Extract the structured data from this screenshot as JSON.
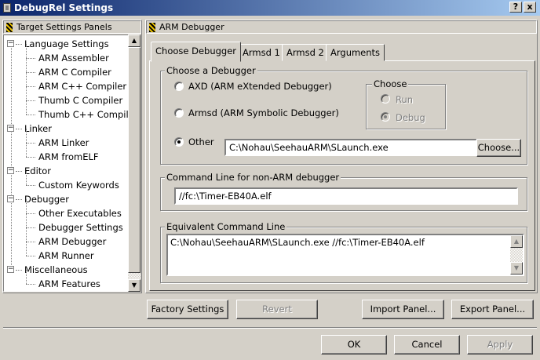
{
  "window": {
    "title": "DebugRel Settings",
    "help_label": "?",
    "close_label": "x"
  },
  "left_panel": {
    "header": "Target Settings Panels",
    "tree": [
      {
        "label": "Language Settings",
        "level": 0,
        "expander": "−"
      },
      {
        "label": "ARM Assembler",
        "level": 1
      },
      {
        "label": "ARM C Compiler",
        "level": 1
      },
      {
        "label": "ARM C++ Compiler",
        "level": 1
      },
      {
        "label": "Thumb C Compiler",
        "level": 1
      },
      {
        "label": "Thumb C++ Compiler",
        "level": 1
      },
      {
        "label": "Linker",
        "level": 0,
        "expander": "−"
      },
      {
        "label": "ARM Linker",
        "level": 1
      },
      {
        "label": "ARM fromELF",
        "level": 1
      },
      {
        "label": "Editor",
        "level": 0,
        "expander": "−"
      },
      {
        "label": "Custom Keywords",
        "level": 1
      },
      {
        "label": "Debugger",
        "level": 0,
        "expander": "−"
      },
      {
        "label": "Other Executables",
        "level": 1
      },
      {
        "label": "Debugger Settings",
        "level": 1
      },
      {
        "label": "ARM Debugger",
        "level": 1
      },
      {
        "label": "ARM Runner",
        "level": 1
      },
      {
        "label": "Miscellaneous",
        "level": 0,
        "expander": "−"
      },
      {
        "label": "ARM Features",
        "level": 1
      }
    ]
  },
  "right_panel": {
    "header": "ARM Debugger",
    "tabs": [
      "Choose Debugger",
      "Armsd 1",
      "Armsd 2",
      "Arguments"
    ],
    "choose_debugger": {
      "group_label": "Choose a Debugger",
      "radio_axd": "AXD (ARM eXtended Debugger)",
      "radio_armsd": "Armsd (ARM Symbolic Debugger)",
      "radio_other": "Other",
      "other_path": "C:\\Nohau\\SeehauARM\\SLaunch.exe",
      "choose_button": "Choose...",
      "choose_group_label": "Choose",
      "run_label": "Run",
      "debug_label": "Debug"
    },
    "cmdline_group_label": "Command Line for non-ARM debugger",
    "cmdline_value": "//fc:\\Timer-EB40A.elf",
    "equiv_group_label": "Equivalent Command Line",
    "equiv_value": "C:\\Nohau\\SeehauARM\\SLaunch.exe //fc:\\Timer-EB40A.elf"
  },
  "panel_buttons": {
    "factory": "Factory Settings",
    "revert": "Revert",
    "import": "Import Panel...",
    "export": "Export Panel..."
  },
  "dialog_buttons": {
    "ok": "OK",
    "cancel": "Cancel",
    "apply": "Apply"
  }
}
